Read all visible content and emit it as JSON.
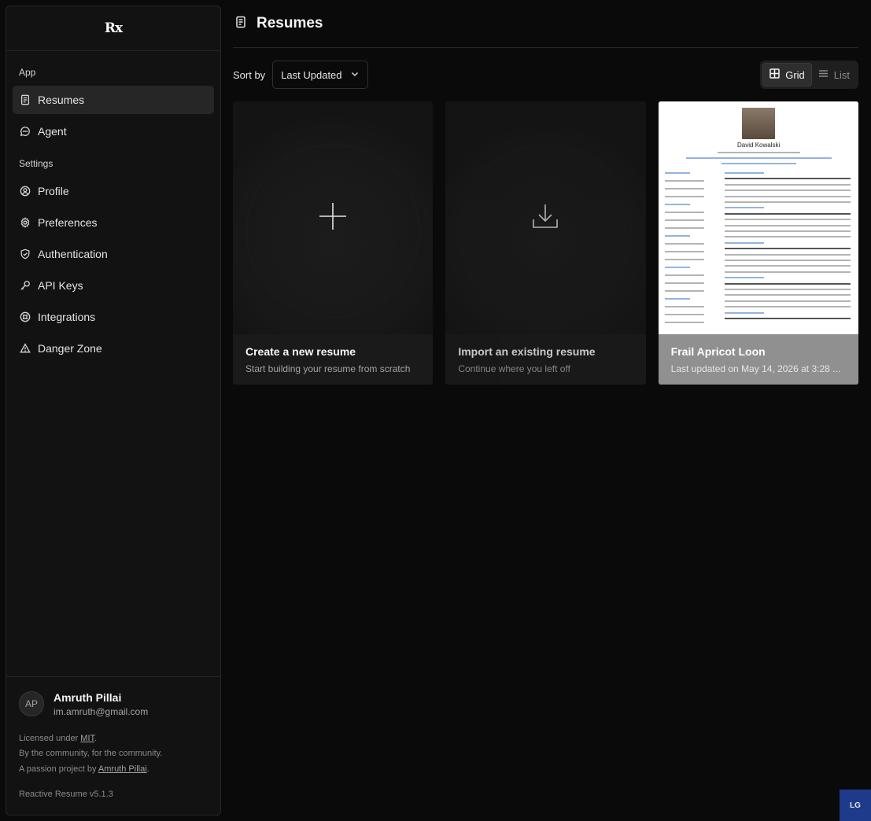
{
  "sidebar": {
    "logo": "Rx",
    "groups": {
      "app": "App",
      "settings": "Settings"
    },
    "app_items": [
      {
        "label": "Resumes",
        "icon": "file-icon"
      },
      {
        "label": "Agent",
        "icon": "chat-icon"
      }
    ],
    "settings_items": [
      {
        "label": "Profile",
        "icon": "user-circle-icon"
      },
      {
        "label": "Preferences",
        "icon": "gear-icon"
      },
      {
        "label": "Authentication",
        "icon": "shield-check-icon"
      },
      {
        "label": "API Keys",
        "icon": "key-icon"
      },
      {
        "label": "Integrations",
        "icon": "integrations-icon"
      },
      {
        "label": "Danger Zone",
        "icon": "warning-icon"
      }
    ],
    "user": {
      "initials": "AP",
      "name": "Amruth Pillai",
      "email": "im.amruth@gmail.com"
    },
    "legal": {
      "licensed_prefix": "Licensed under ",
      "license": "MIT",
      "licensed_suffix": ".",
      "community": "By the community, for the community.",
      "passion_prefix": "A passion project by ",
      "author": "Amruth Pillai",
      "passion_suffix": "."
    },
    "version": "Reactive Resume v5.1.3"
  },
  "main": {
    "title": "Resumes",
    "sort_label": "Sort by",
    "sort_value": "Last Updated",
    "view": {
      "grid": "Grid",
      "list": "List",
      "selected": "Grid"
    },
    "cards": [
      {
        "title": "Create a new resume",
        "subtitle": "Start building your resume from scratch",
        "icon": "plus-icon"
      },
      {
        "title": "Import an existing resume",
        "subtitle": "Continue where you left off",
        "icon": "download-icon"
      },
      {
        "title": "Frail Apricot Loon",
        "subtitle": "Last updated on May 14, 2026 at 3:28 ...",
        "preview_name": "David Kowalski"
      }
    ]
  },
  "badge": "LG"
}
